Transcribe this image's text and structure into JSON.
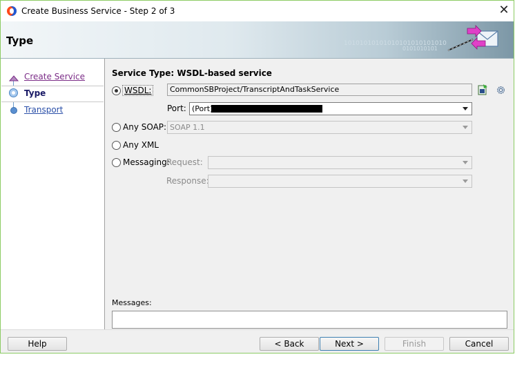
{
  "window": {
    "title": "Create Business Service - Step 2 of 3",
    "close_glyph": "✕"
  },
  "header": {
    "title": "Type",
    "binary_line1": "10101010101010101010101010",
    "binary_line2": "0101010101"
  },
  "nav": {
    "items": [
      {
        "label": "Create Service",
        "state": "visited"
      },
      {
        "label": "Type",
        "state": "current"
      },
      {
        "label": "Transport",
        "state": "pending"
      }
    ]
  },
  "form": {
    "service_type_label": "Service Type: WSDL-based service",
    "wsdl": {
      "label": "WSDL:",
      "value": "CommonSBProject/TranscriptAndTaskService",
      "selected": true,
      "browse_icon": "wsdl-browse-icon",
      "gear_icon": "gear-icon"
    },
    "port": {
      "label": "Port:",
      "value": "(Port)"
    },
    "any_soap": {
      "label": "Any SOAP:",
      "value": "SOAP 1.1"
    },
    "any_xml": {
      "label": "Any XML"
    },
    "messaging": {
      "label": "Messaging:",
      "request_label": "Request:",
      "response_label": "Response:"
    }
  },
  "messages": {
    "label": "Messages:",
    "value": ""
  },
  "buttons": {
    "help": "Help",
    "back": "< Back",
    "next": "Next >",
    "finish": "Finish",
    "cancel": "Cancel"
  },
  "colors": {
    "dialog_border": "#8ccb63",
    "nav_link": "#7b2c87",
    "nav_dot": "#5a8fd0"
  }
}
